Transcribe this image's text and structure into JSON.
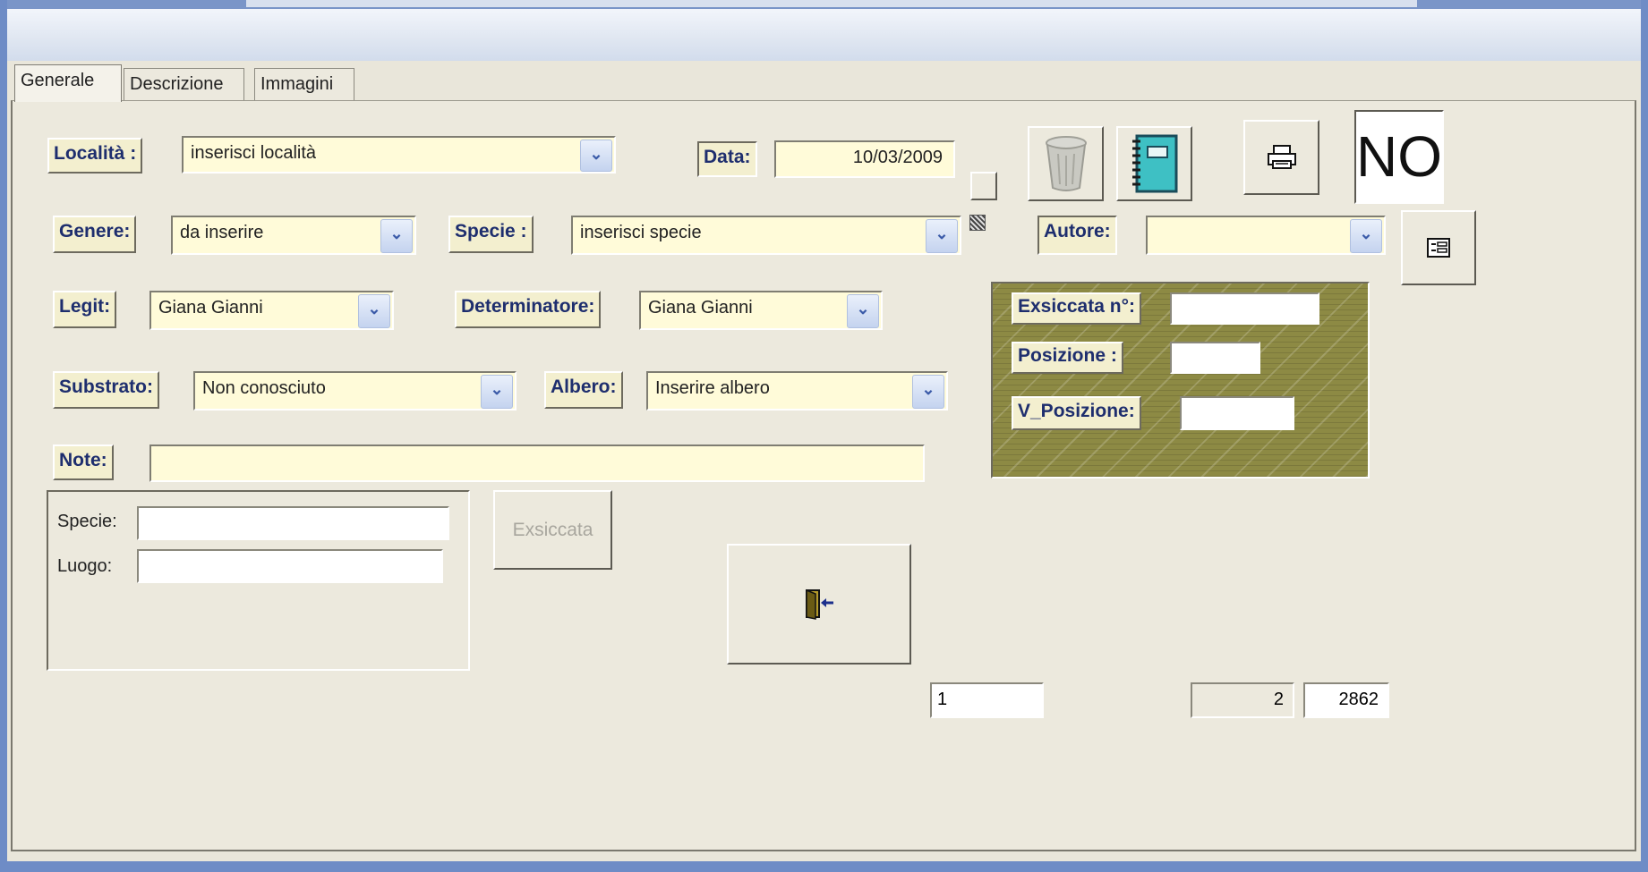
{
  "tabs": [
    {
      "label": "Generale"
    },
    {
      "label": "Descrizione"
    },
    {
      "label": "Immagini"
    }
  ],
  "fields": {
    "localita_label": "Località :",
    "localita_value": "inserisci località",
    "data_label": "Data:",
    "data_value": "10/03/2009",
    "genere_label": "Genere:",
    "genere_value": "da inserire",
    "specie_label": "Specie :",
    "specie_value": "inserisci specie",
    "autore_label": "Autore:",
    "autore_value": "",
    "legit_label": "Legit:",
    "legit_value": "Giana Gianni",
    "determinatore_label": "Determinatore:",
    "determinatore_value": "Giana Gianni",
    "substrato_label": "Substrato:",
    "substrato_value": "Non conosciuto",
    "albero_label": "Albero:",
    "albero_value": "Inserire albero",
    "note_label": "Note:",
    "note_value": ""
  },
  "exsiccata_panel": {
    "numero_label": "Exsiccata  n°:",
    "posizione_label": "Posizione :",
    "v_posizione_label": "V_Posizione:"
  },
  "search": {
    "specie_label": "Specie:",
    "luogo_label": "Luogo:",
    "exsiccata_button": "Exsiccata"
  },
  "flag": "NO",
  "counters": {
    "record": "1",
    "current": "2",
    "total": "2862"
  },
  "icons": [
    "trash-icon",
    "notebook-icon",
    "printer-icon",
    "form-icon",
    "exit-door-icon"
  ],
  "colors": {
    "field_bg": "#fffbd9",
    "label_text": "#1e2e6e",
    "panel_bg": "#8d8a44",
    "frame": "#6e8cc6"
  }
}
